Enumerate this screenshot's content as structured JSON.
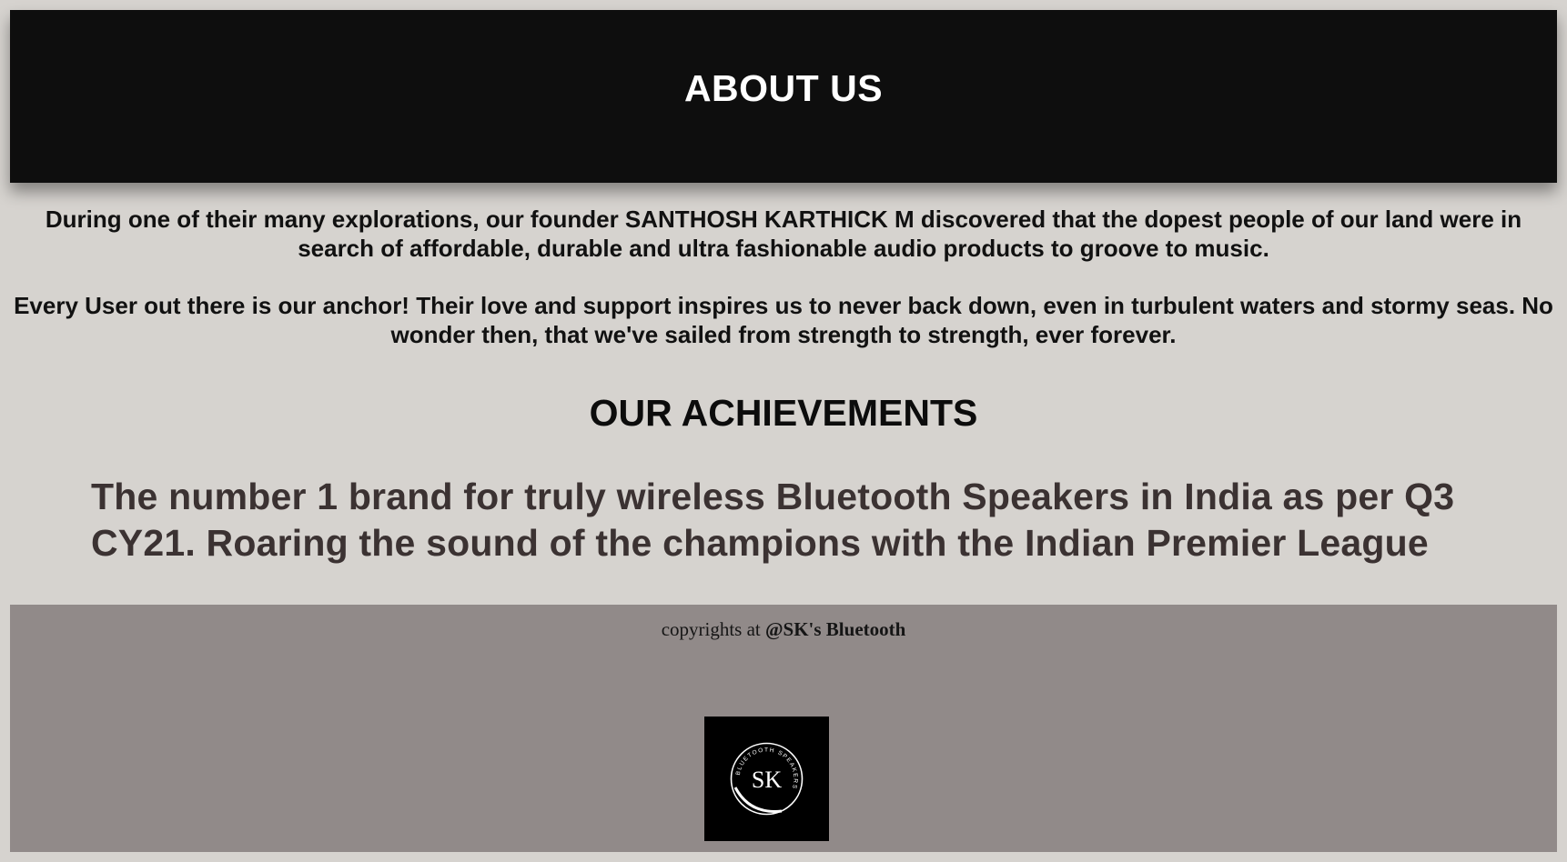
{
  "header": {
    "title": "ABOUT US"
  },
  "about": {
    "paragraph_1": "During one of their many explorations, our founder SANTHOSH KARTHICK M discovered that the dopest people of our land were in search of affordable, durable and ultra fashionable audio products to groove to music.",
    "paragraph_2": "Every User out there is our anchor! Their love and support inspires us to never back down, even in turbulent waters and stormy seas. No wonder then, that we've sailed from strength to strength, ever forever."
  },
  "achievements": {
    "title": "OUR ACHIEVEMENTS",
    "text": "The number 1 brand for truly wireless Bluetooth Speakers in India as per Q3 CY21. Roaring the sound of the champions with the Indian Premier League"
  },
  "footer": {
    "copyright_prefix": "copyrights at ",
    "copyright_brand": "@SK's Bluetooth",
    "logo": {
      "icon": "sk-bluetooth-speakers-logo",
      "monogram": "SK",
      "ring_text": "BLUETOOTH SPEAKERS"
    }
  },
  "colors": {
    "page_background": "#d6d3cf",
    "header_background": "#0e0e0e",
    "footer_background": "#918a89",
    "achievement_text": "#3b3232"
  }
}
